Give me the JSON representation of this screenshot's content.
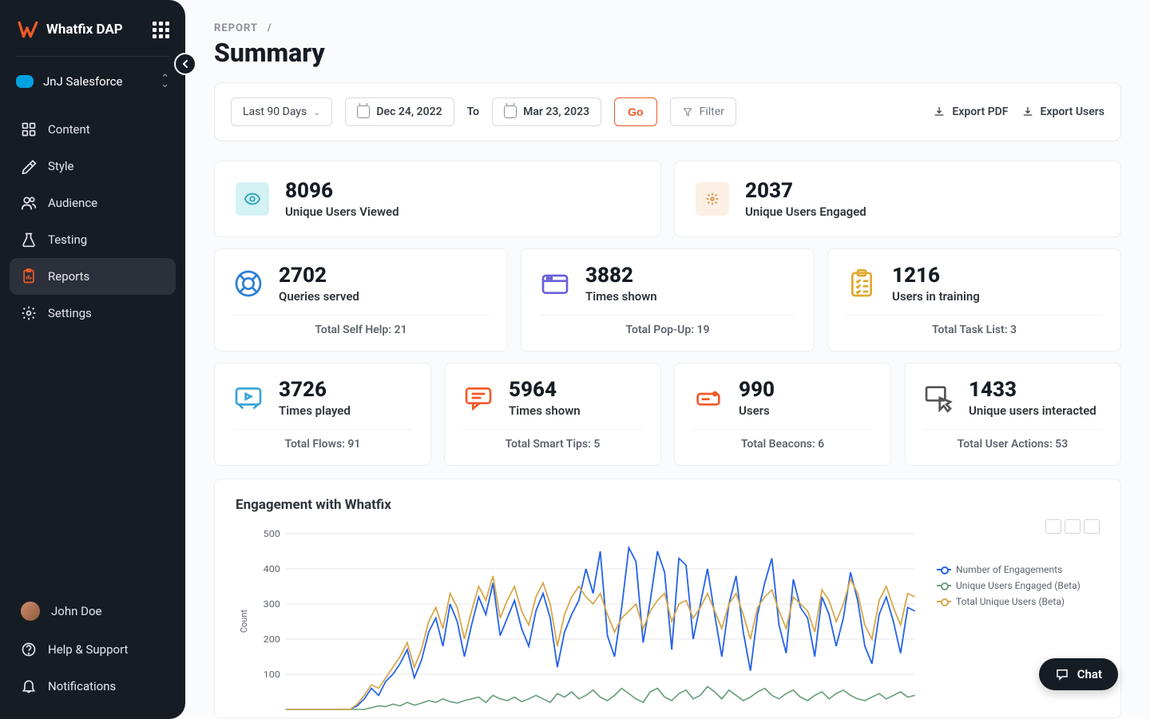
{
  "app": {
    "name": "Whatfix DAP"
  },
  "workspace": {
    "name": "JnJ Salesforce"
  },
  "sidebar": {
    "items": [
      {
        "label": "Content"
      },
      {
        "label": "Style"
      },
      {
        "label": "Audience"
      },
      {
        "label": "Testing"
      },
      {
        "label": "Reports"
      },
      {
        "label": "Settings"
      }
    ],
    "bottom": {
      "user": "John Doe",
      "help": "Help & Support",
      "notifications": "Notifications"
    }
  },
  "breadcrumb": {
    "section": "REPORT",
    "sep": "/"
  },
  "page_title": "Summary",
  "toolbar": {
    "range_label": "Last 90 Days",
    "from_date": "Dec 24, 2022",
    "to_label": "To",
    "to_date": "Mar 23, 2023",
    "go_label": "Go",
    "filter_label": "Filter",
    "export_pdf": "Export PDF",
    "export_users": "Export Users"
  },
  "metrics": {
    "viewed": {
      "value": "8096",
      "label": "Unique Users Viewed"
    },
    "engaged": {
      "value": "2037",
      "label": "Unique Users Engaged"
    },
    "selfhelp": {
      "value": "2702",
      "label": "Queries served",
      "footer": "Total Self Help: 21"
    },
    "popup": {
      "value": "3882",
      "label": "Times shown",
      "footer": "Total Pop-Up: 19"
    },
    "tasklist": {
      "value": "1216",
      "label": "Users in training",
      "footer": "Total Task List: 3"
    },
    "flows": {
      "value": "3726",
      "label": "Times played",
      "footer": "Total Flows: 91"
    },
    "smarttips": {
      "value": "5964",
      "label": "Times shown",
      "footer": "Total Smart Tips: 5"
    },
    "beacons": {
      "value": "990",
      "label": "Users",
      "footer": "Total Beacons: 6"
    },
    "useractions": {
      "value": "1433",
      "label": "Unique users interacted",
      "footer": "Total User Actions: 53"
    }
  },
  "chart": {
    "title": "Engagement with Whatfix",
    "ylabel": "Count",
    "legend": {
      "a": "Number of Engagements",
      "b": "Unique Users Engaged (Beta)",
      "c": "Total Unique Users (Beta)"
    }
  },
  "chart_data": {
    "type": "line",
    "ylabel": "Count",
    "ylim": [
      0,
      500
    ],
    "yticks": [
      100,
      200,
      300,
      400,
      500
    ],
    "series": [
      {
        "name": "Number of Engagements",
        "color": "#2563eb",
        "values": [
          0,
          0,
          0,
          0,
          0,
          0,
          0,
          0,
          0,
          0,
          10,
          30,
          60,
          40,
          80,
          100,
          130,
          170,
          90,
          140,
          220,
          260,
          180,
          300,
          250,
          150,
          240,
          320,
          270,
          360,
          210,
          260,
          310,
          230,
          180,
          280,
          330,
          260,
          120,
          220,
          270,
          310,
          400,
          330,
          450,
          210,
          150,
          290,
          460,
          420,
          190,
          310,
          450,
          390,
          170,
          430,
          410,
          200,
          300,
          400,
          270,
          150,
          300,
          380,
          220,
          110,
          270,
          360,
          430,
          240,
          160,
          370,
          290,
          260,
          150,
          320,
          270,
          180,
          260,
          390,
          310,
          180,
          130,
          270,
          320,
          250,
          160,
          290,
          280
        ]
      },
      {
        "name": "Unique Users Engaged (Beta)",
        "color": "#6ca07c",
        "values": [
          0,
          0,
          0,
          0,
          0,
          0,
          0,
          0,
          0,
          0,
          0,
          0,
          5,
          10,
          8,
          15,
          10,
          20,
          12,
          18,
          25,
          20,
          30,
          22,
          18,
          25,
          30,
          35,
          20,
          40,
          30,
          25,
          35,
          22,
          30,
          40,
          30,
          20,
          45,
          35,
          50,
          30,
          40,
          55,
          35,
          25,
          40,
          60,
          45,
          30,
          20,
          50,
          60,
          35,
          25,
          45,
          55,
          30,
          40,
          65,
          50,
          30,
          55,
          40,
          25,
          35,
          50,
          60,
          40,
          30,
          45,
          55,
          35,
          25,
          40,
          50,
          30,
          45,
          55,
          40,
          30,
          25,
          35,
          45,
          30,
          40,
          50,
          35,
          40
        ]
      },
      {
        "name": "Total Unique Users (Beta)",
        "color": "#d6a84a",
        "values": [
          0,
          0,
          0,
          0,
          0,
          0,
          0,
          0,
          0,
          0,
          15,
          40,
          70,
          60,
          90,
          120,
          150,
          190,
          120,
          170,
          250,
          290,
          230,
          330,
          290,
          200,
          280,
          350,
          310,
          380,
          260,
          310,
          350,
          280,
          240,
          320,
          360,
          300,
          180,
          270,
          320,
          350,
          320,
          300,
          330,
          270,
          220,
          260,
          280,
          300,
          230,
          280,
          310,
          330,
          250,
          300,
          310,
          260,
          290,
          330,
          280,
          230,
          300,
          330,
          270,
          200,
          290,
          320,
          340,
          280,
          230,
          320,
          300,
          280,
          220,
          340,
          310,
          250,
          300,
          370,
          330,
          240,
          200,
          310,
          350,
          290,
          240,
          330,
          320
        ]
      }
    ]
  },
  "chat": {
    "label": "Chat"
  }
}
